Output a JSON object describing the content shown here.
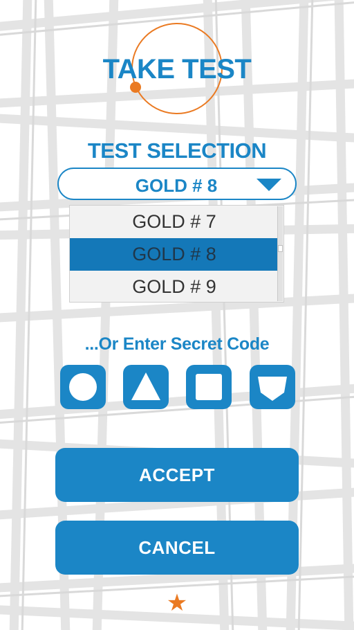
{
  "header": {
    "title": "TAKE TEST"
  },
  "selection": {
    "label": "TEST SELECTION",
    "selected_value": "GOLD # 8",
    "options": [
      "GOLD # 7",
      "GOLD # 8",
      "GOLD # 9"
    ],
    "selected_index": 1
  },
  "secret_code": {
    "label": "...Or Enter Secret Code",
    "shapes": [
      "circle-icon",
      "triangle-icon",
      "square-icon",
      "pentagon-icon"
    ]
  },
  "actions": {
    "accept_label": "ACCEPT",
    "cancel_label": "CANCEL"
  },
  "footer": {
    "icon": "star-icon"
  },
  "colors": {
    "primary": "#1b86c6",
    "accent": "#ea7a22",
    "selected_row": "#1478b8",
    "background_pattern": "#e3e3e3"
  }
}
